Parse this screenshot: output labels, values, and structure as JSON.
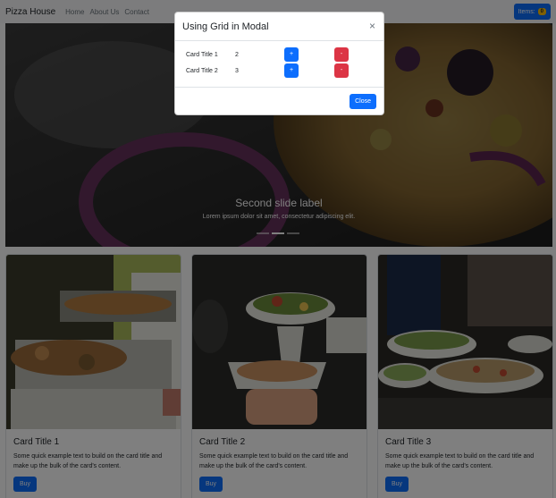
{
  "navbar": {
    "brand": "Pizza House",
    "links": [
      "Home",
      "About Us",
      "Contact"
    ],
    "items_label": "Items:",
    "items_count": "0"
  },
  "carousel": {
    "caption_title": "Second slide label",
    "caption_text": "Lorem ipsum dolor sit amet, consectetur adipiscing elit.",
    "active_index": 1,
    "slide_count": 3
  },
  "cards": [
    {
      "title": "Card Title 1",
      "text": "Some quick example text to build on the card title and make up the bulk of the card's content.",
      "button": "Buy"
    },
    {
      "title": "Card Title 2",
      "text": "Some quick example text to build on the card title and make up the bulk of the card's content.",
      "button": "Buy"
    },
    {
      "title": "Card Title 3",
      "text": "Some quick example text to build on the card title and make up the bulk of the card's content.",
      "button": "Buy"
    }
  ],
  "modal": {
    "title": "Using Grid in Modal",
    "close_symbol": "×",
    "rows": [
      {
        "title": "Card Title 1",
        "qty": "2",
        "plus": "+",
        "minus": "-"
      },
      {
        "title": "Card Title 2",
        "qty": "3",
        "plus": "+",
        "minus": "-"
      }
    ],
    "close_button": "Close"
  },
  "colors": {
    "primary": "#0d6efd",
    "danger": "#dc3545",
    "badge": "#ffc107",
    "navbar_bg": "#f8f9fa"
  },
  "icons": {
    "close": "close-icon"
  }
}
